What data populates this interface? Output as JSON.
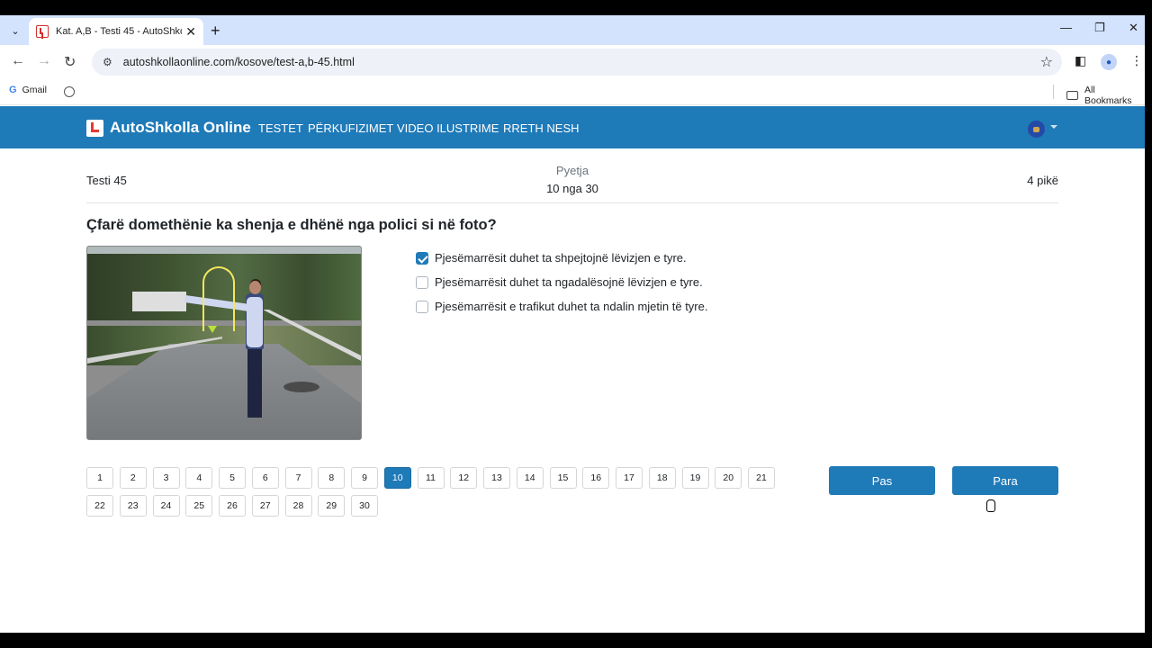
{
  "browser": {
    "tab_title": "Kat. A,B - Testi 45 - AutoShkolla",
    "url": "autoshkollaonline.com/kosove/test-a,b-45.html",
    "bookmarks": [
      {
        "label": "Gmail"
      }
    ],
    "all_bookmarks": "All Bookmarks"
  },
  "site": {
    "brand": "AutoShkolla Online",
    "nav": [
      "TESTET",
      "PËRKUFIZIMET",
      "VIDEO ILUSTRIME",
      "RRETH NESH"
    ]
  },
  "quiz": {
    "test_name": "Testi 45",
    "question_label": "Pyetja",
    "question_count": "10 nga 30",
    "points": "4 pikë",
    "question": "Çfarë domethënie ka shenja e dhënë nga polici si në foto?",
    "answers": [
      {
        "text": "Pjesëmarrësit duhet ta shpejtojnë lëvizjen e tyre.",
        "checked": true
      },
      {
        "text": "Pjesëmarrësit duhet ta ngadalësojnë lëvizjen e tyre.",
        "checked": false
      },
      {
        "text": "Pjesëmarrësit e trafikut duhet ta ndalin mjetin të tyre.",
        "checked": false
      }
    ],
    "pages": [
      "1",
      "2",
      "3",
      "4",
      "5",
      "6",
      "7",
      "8",
      "9",
      "10",
      "11",
      "12",
      "13",
      "14",
      "15",
      "16",
      "17",
      "18",
      "19",
      "20",
      "21",
      "22",
      "23",
      "24",
      "25",
      "26",
      "27",
      "28",
      "29",
      "30"
    ],
    "active_page": "10",
    "prev_label": "Pas",
    "next_label": "Para"
  },
  "colors": {
    "primary": "#1f7ab8",
    "tabstrip": "#d3e3fd"
  }
}
